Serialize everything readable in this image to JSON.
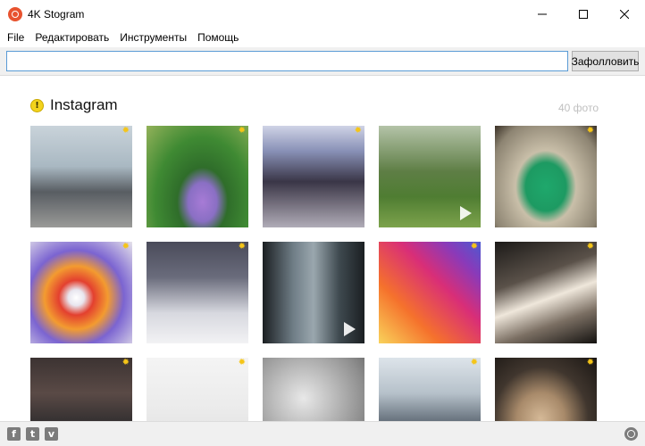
{
  "window": {
    "title": "4K Stogram"
  },
  "menu": [
    "File",
    "Редактировать",
    "Инструменты",
    "Помощь"
  ],
  "toolbar": {
    "url_value": "",
    "follow_label": "Зафолловить"
  },
  "section": {
    "title": "Instagram",
    "count": "40 фото"
  },
  "tiles": [
    {
      "bg": "linear-gradient(180deg,#c9d3da 0%,#a9b8c2 40%,#585d62 65%,#9a9a98 100%)",
      "star": true,
      "play": false
    },
    {
      "bg": "radial-gradient(ellipse at 55% 75%,#a77bd6 0%,#8a6fc4 18%,#2f6d2a 32%,#3f8a33 60%,#93b25a 100%)",
      "star": true,
      "play": false
    },
    {
      "bg": "linear-gradient(180deg,#cfd3e6 0%,#8890b6 25%,#3a3647 55%,#6f6a78 75%,#b0acb7 100%)",
      "star": true,
      "play": false
    },
    {
      "bg": "linear-gradient(180deg,#b4c3a8 0%,#5e7e45 45%,#4f7d32 70%,#7da34c 100%)",
      "star": false,
      "play": true
    },
    {
      "bg": "radial-gradient(ellipse at 50% 60%,#1fa86c 0%,#1d9a62 28%,#c9bfa9 42%,#8d8472 80%,#3a3126 100%)",
      "star": true,
      "play": false
    },
    {
      "bg": "radial-gradient(circle at 45% 55%,#ffffff 0%,#e8e6ef 10%,#e3402f 22%,#f39b30 40%,#7b64d1 60%,#e6e3ea 100%)",
      "star": true,
      "play": false
    },
    {
      "bg": "linear-gradient(180deg,#4a4b5a 0%,#6a6c7c 35%,#d7d8df 70%,#f2f2f4 100%)",
      "star": true,
      "play": false
    },
    {
      "bg": "linear-gradient(90deg,#1b1f22 0%,#6f7d86 30%,#9aa7ae 50%,#3f4a50 75%,#1b1f22 100%)",
      "star": false,
      "play": true
    },
    {
      "bg": "linear-gradient(45deg,#f9d35b 0%,#f5722c 30%,#d92e77 60%,#8a3ab9 82%,#4c5ad1 100%)",
      "star": true,
      "play": false
    },
    {
      "bg": "linear-gradient(160deg,#1c1a18 0%,#5a5149 35%,#efe7db 55%,#7b6f63 75%,#141210 100%)",
      "star": true,
      "play": false
    },
    {
      "bg": "linear-gradient(180deg,#3c3332 0%,#5a4a46 35%,#2b2a2c 70%,#6c6e75 100%)",
      "star": true,
      "play": false
    },
    {
      "bg": "linear-gradient(180deg,#f4f4f4 0%,#ebebeb 50%,#dcdcdc 100%)",
      "star": true,
      "play": false
    },
    {
      "bg": "radial-gradient(circle at 40% 40%,#e8e8e8 0%,#bcbcbc 35%,#8e8e8e 70%,#5e5e5e 100%)",
      "star": false,
      "play": false
    },
    {
      "bg": "linear-gradient(180deg,#dde4ea 0%,#b6c1ca 35%,#5f6a75 65%,#2c333a 100%)",
      "star": true,
      "play": false
    },
    {
      "bg": "radial-gradient(ellipse at 45% 60%,#d5b997 0%,#a88a6a 30%,#40362e 60%,#1a1613 100%)",
      "star": true,
      "play": false
    }
  ],
  "colors": {
    "accent": "#5a9bd5",
    "star": "#f5c518"
  },
  "status_icons": [
    "facebook-icon",
    "twitter-icon",
    "vimeo-icon",
    "globe-icon"
  ]
}
